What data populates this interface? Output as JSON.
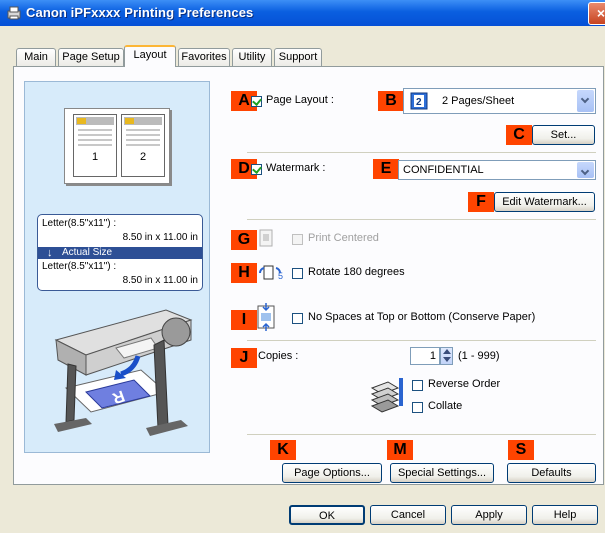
{
  "window": {
    "title": "Canon iPFxxxx Printing Preferences",
    "close_label": "×"
  },
  "tabs": [
    {
      "label": "Main"
    },
    {
      "label": "Page Setup"
    },
    {
      "label": "Layout",
      "active": true
    },
    {
      "label": "Favorites"
    },
    {
      "label": "Utility"
    },
    {
      "label": "Support"
    }
  ],
  "preview": {
    "page_numbers": [
      "1",
      "2"
    ],
    "size_original_label": "Letter(8.5\"x11\") :",
    "size_original_value": "8.50 in x 11.00 in",
    "actual_size_label": "Actual Size",
    "size_output_label": "Letter(8.5\"x11\") :",
    "size_output_value": "8.50 in x 11.00 in",
    "output_sheet_letter": "R"
  },
  "markers": {
    "A": "A",
    "B": "B",
    "C": "C",
    "D": "D",
    "E": "E",
    "F": "F",
    "G": "G",
    "H": "H",
    "I": "I",
    "J": "J",
    "K": "K",
    "M": "M",
    "S": "S"
  },
  "layout": {
    "page_layout_label": "Page Layout :",
    "page_layout_checked": true,
    "page_layout_select": "2 Pages/Sheet",
    "set_button": "Set...",
    "watermark_label": "Watermark :",
    "watermark_checked": true,
    "watermark_select": "CONFIDENTIAL",
    "edit_watermark_button": "Edit Watermark...",
    "print_centered_label": "Print Centered",
    "print_centered_enabled": false,
    "rotate_label": "Rotate 180 degrees",
    "rotate_checked": false,
    "no_spaces_label": "No Spaces at Top or Bottom (Conserve Paper)",
    "no_spaces_checked": false,
    "copies_label": "Copies :",
    "copies_value": "1",
    "copies_range": "(1 - 999)",
    "reverse_order_label": "Reverse Order",
    "reverse_order_checked": false,
    "collate_label": "Collate",
    "collate_checked": false,
    "page_options_button": "Page Options...",
    "special_settings_button": "Special Settings...",
    "defaults_button": "Defaults"
  },
  "dialog_buttons": {
    "ok": "OK",
    "cancel": "Cancel",
    "apply": "Apply",
    "help": "Help"
  },
  "colors": {
    "marker": "#ff4400",
    "titlebar": "#0a5fe0",
    "preview_bg": "#d7ebfa",
    "actual_size_bar": "#2d4f95"
  }
}
